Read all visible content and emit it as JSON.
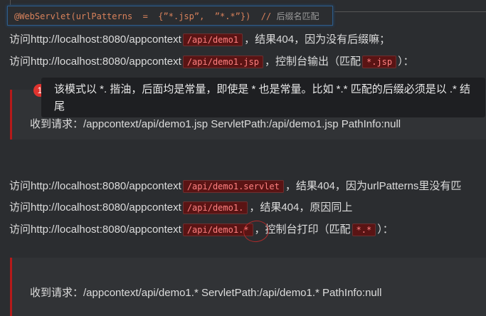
{
  "code_block": {
    "code": "@WebServlet(urlPatterns  =  {”*.jsp”,  ”*.*”})  // ",
    "comment": "后缀名匹配"
  },
  "lines": [
    {
      "prefix": "访问http://localhost:8080/appcontext",
      "code": "/api/demo1",
      "suffix": "，结果404，因为没有后缀嘛；"
    },
    {
      "prefix": "访问http://localhost:8080/appcontext",
      "code": "/api/demo1.jsp",
      "suffix": "，控制台输出（匹配",
      "code2": "*.jsp",
      "suffix2": "）："
    },
    {
      "prefix": "访问http://localhost:8080/appcontext",
      "code": "/api/demo1.servlet",
      "suffix": "，结果404，因为urlPatterns里没有匹"
    },
    {
      "prefix": "访问http://localhost:8080/appcontext",
      "code": "/api/demo1.",
      "suffix": "，结果404，原因同上"
    },
    {
      "prefix": "访问http://localhost:8080/appcontext",
      "code": "/api/demo1.*",
      "suffix": "，控制台打印（匹配",
      "code2": "*.*",
      "suffix2": "）："
    }
  ],
  "quotes": [
    "收到请求：/appcontext/api/demo1.jsp ServletPath:/api/demo1.jsp PathInfo:null",
    "收到请求：/appcontext/api/demo1.* ServletPath:/api/demo1.* PathInfo:null"
  ],
  "annotation": {
    "number": "1",
    "text": "该模式以 *. 揩油，后面均是常量，即使是 * 也是常量。比如 *.* 匹配的后缀必须是以 .* 结尾",
    "color": "#e0332e"
  },
  "colors": {
    "background": "#2b2d30",
    "quote_border": "#b51a1a",
    "code_bg": "#5a1414",
    "code_text": "#ff8080"
  }
}
